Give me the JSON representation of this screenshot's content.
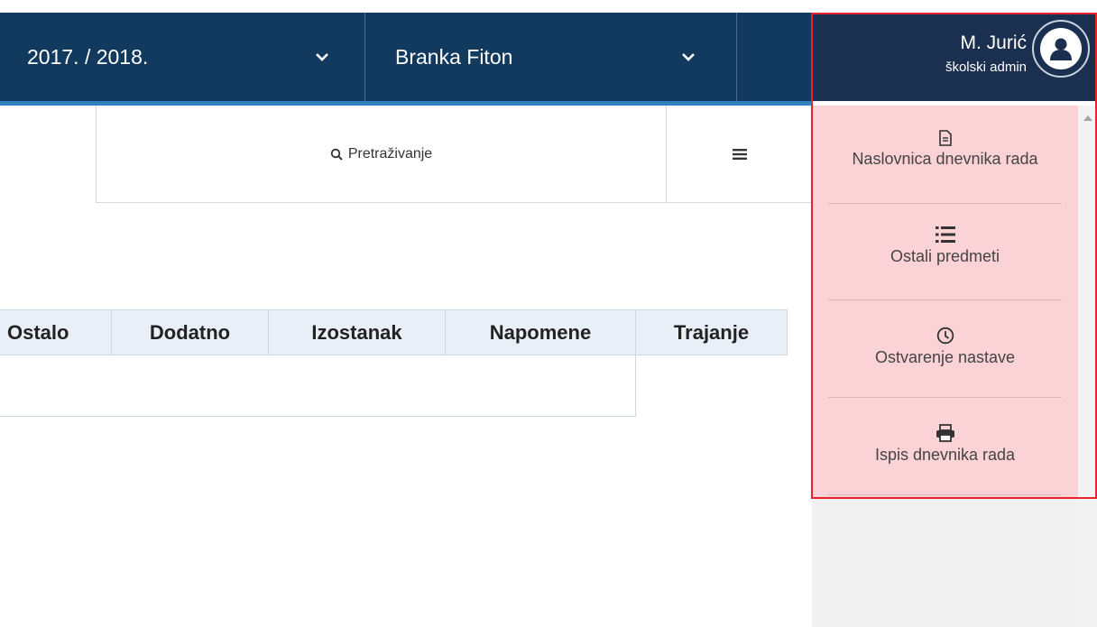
{
  "header": {
    "year_select": "2017. / 2018.",
    "teacher_select": "Branka Fiton",
    "user_name": "M. Jurić",
    "user_role": "školski admin"
  },
  "toolbar": {
    "search_label": "Pretraživanje"
  },
  "table": {
    "columns": [
      "Ostalo",
      "Dodatno",
      "Izostanak",
      "Napomene",
      "Trajanje"
    ]
  },
  "user_menu": {
    "items": [
      {
        "label": "Naslovnica dnevnika rada",
        "icon": "document-icon"
      },
      {
        "label": "Ostali predmeti",
        "icon": "list-icon"
      },
      {
        "label": "Ostvarenje nastave",
        "icon": "clock-icon"
      },
      {
        "label": "Ispis dnevnika rada",
        "icon": "printer-icon"
      }
    ]
  },
  "colors": {
    "navbar": "#123a5f",
    "user_box": "#1b2f50",
    "accent": "#2f7fc1",
    "highlight": "#fbd2d6",
    "frame": "#e8232f"
  }
}
